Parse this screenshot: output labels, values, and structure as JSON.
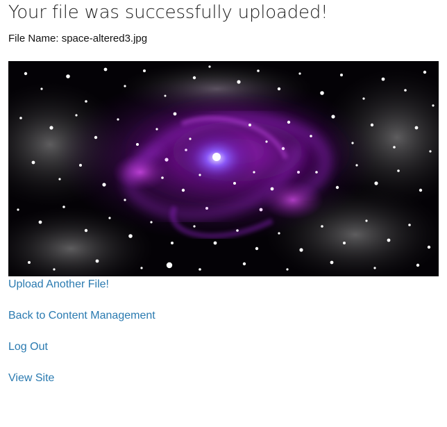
{
  "page": {
    "title": "Your file was successfully uploaded!",
    "file_label": "File Name:",
    "file_name": "space-altered3.jpg"
  },
  "image": {
    "alt": "space-altered3.jpg"
  },
  "links": {
    "upload_another": "Upload Another File!",
    "back_to_content": "Back to Content Management",
    "log_out": "Log Out",
    "view_site": "View Site"
  },
  "colors": {
    "link": "#2a7ab0",
    "title": "#1f1f1f"
  }
}
